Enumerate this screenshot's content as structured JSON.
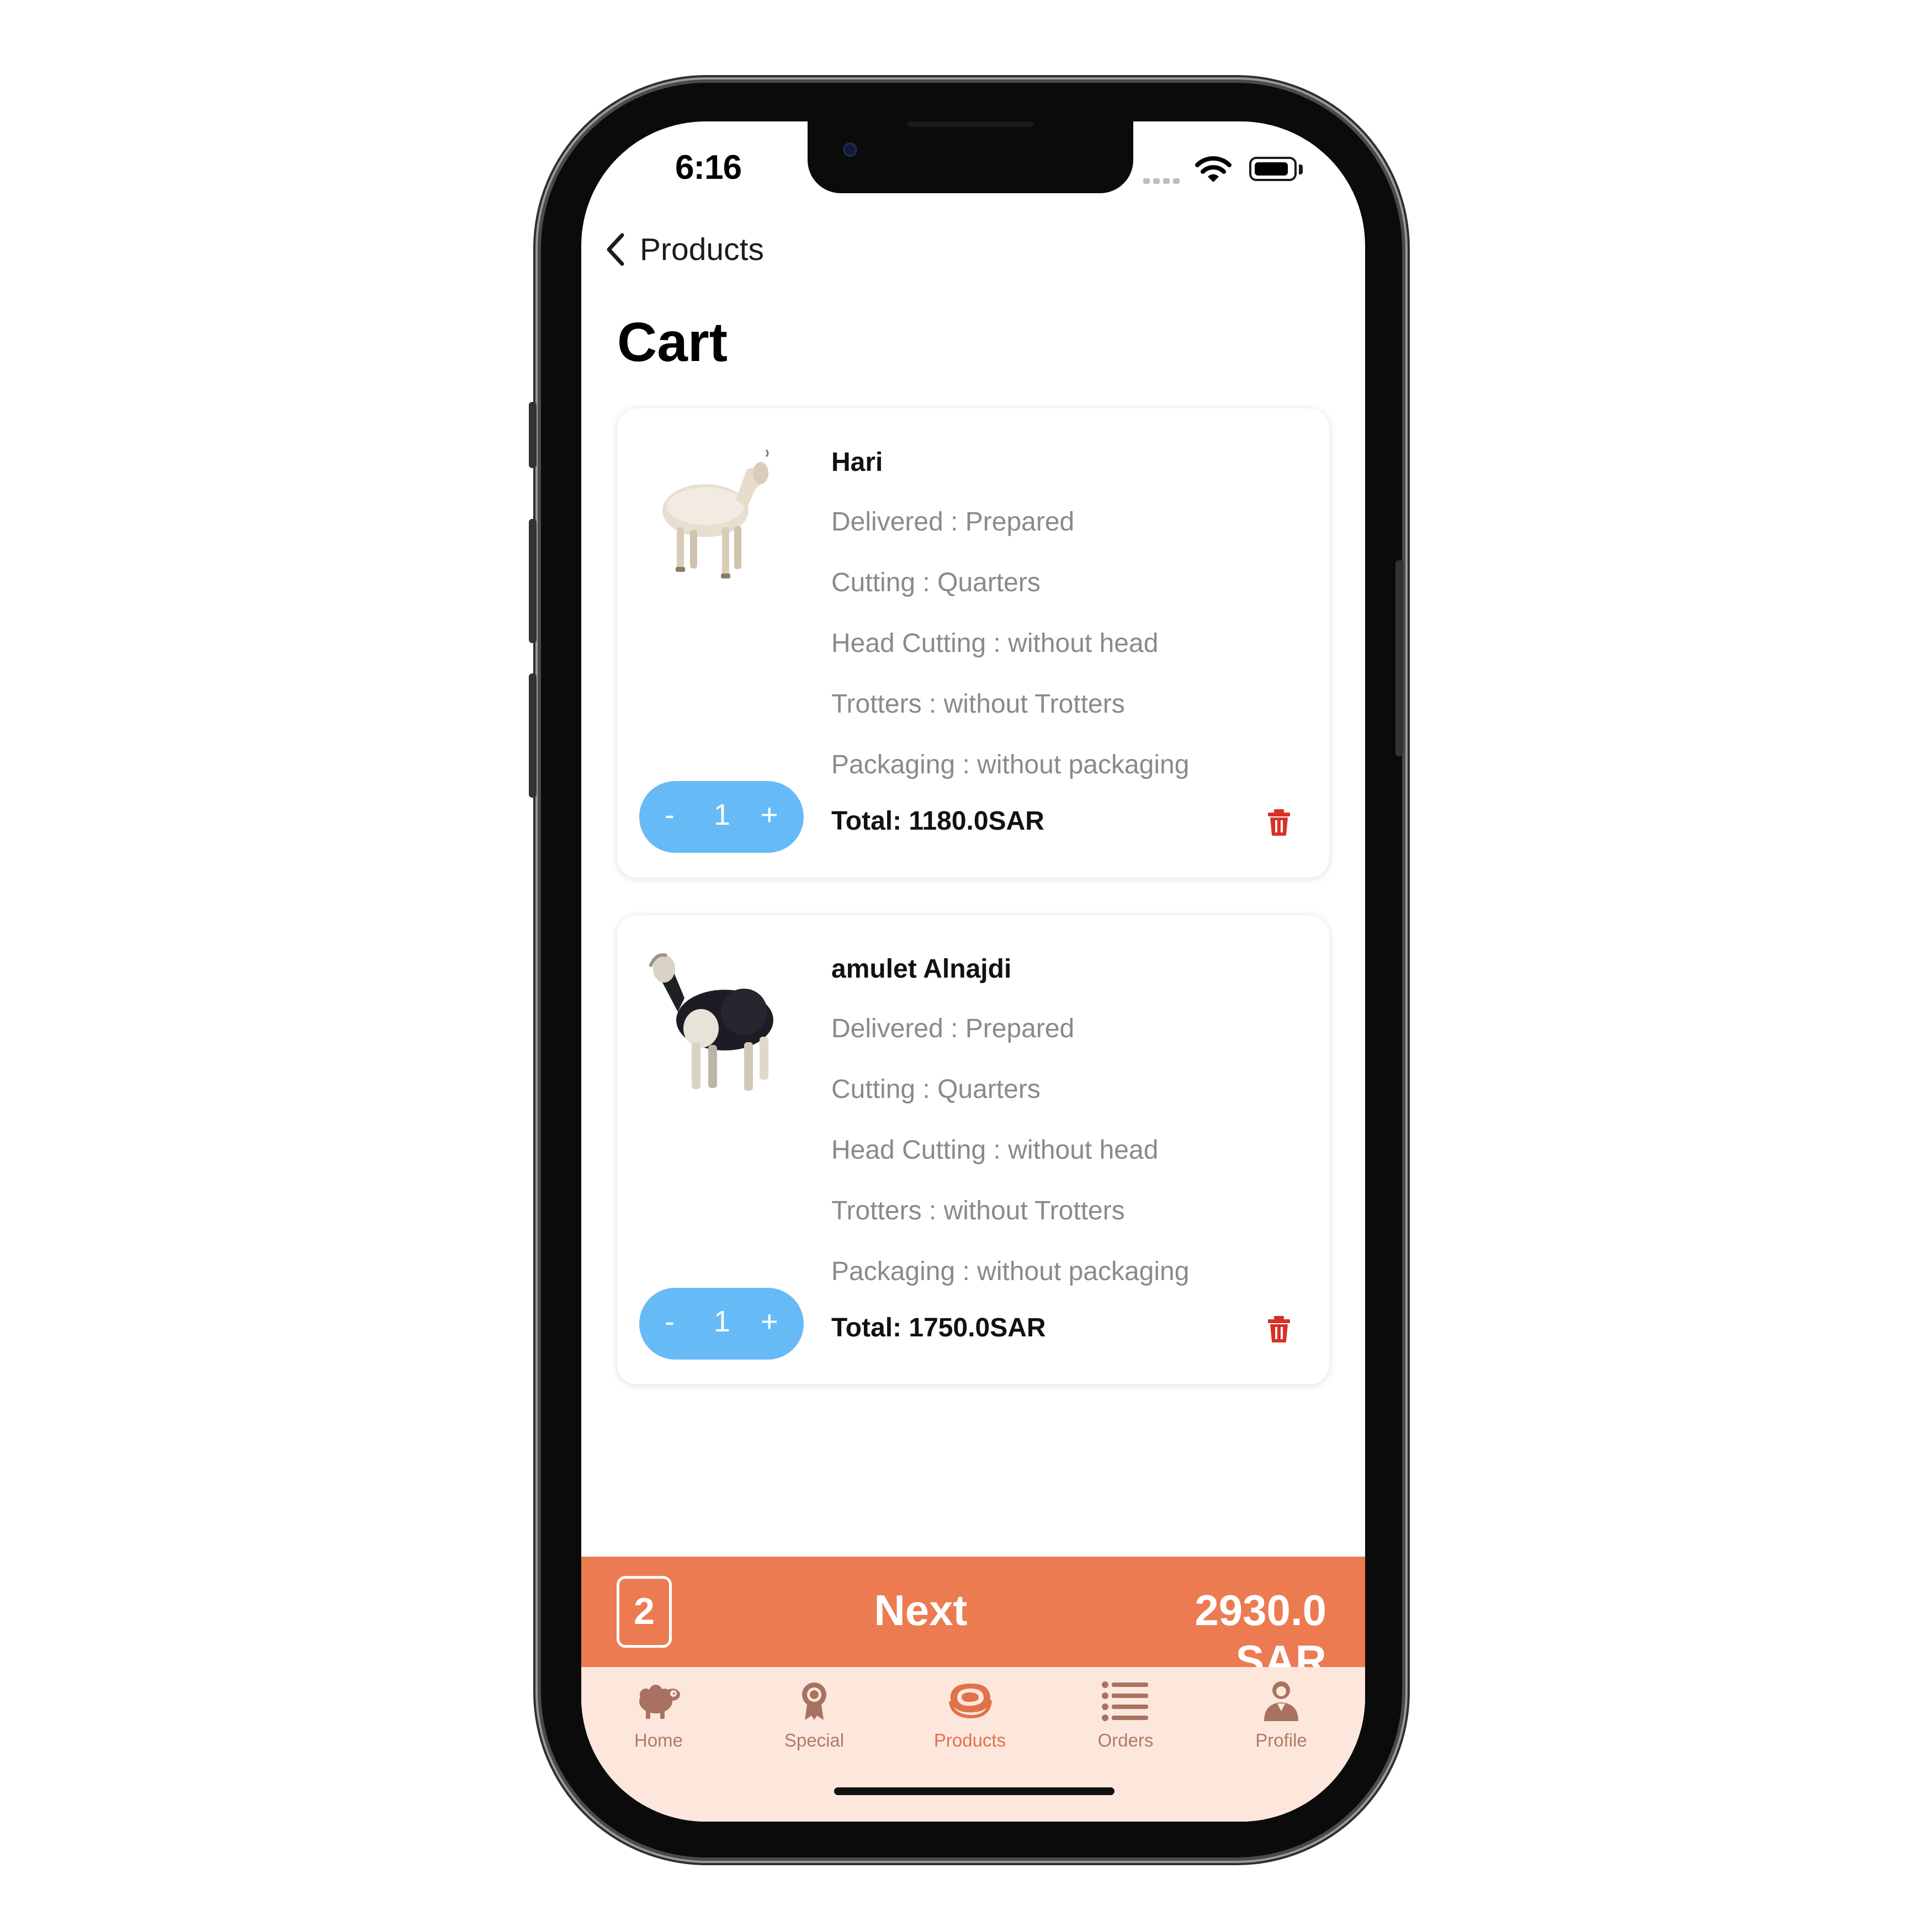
{
  "status_bar": {
    "time": "6:16"
  },
  "nav": {
    "back_label": "Products"
  },
  "page": {
    "title": "Cart"
  },
  "cart_items": [
    {
      "name": "Hari",
      "delivered": "Delivered : Prepared",
      "cutting": "Cutting : Quarters",
      "head_cutting": "Head Cutting : without head",
      "trotters": "Trotters : without Trotters",
      "packaging": "Packaging : without packaging",
      "total": "Total: 1180.0SAR",
      "quantity": "1",
      "minus": "-",
      "plus": "+"
    },
    {
      "name": "amulet Alnajdi",
      "delivered": "Delivered : Prepared",
      "cutting": "Cutting : Quarters",
      "head_cutting": "Head Cutting : without head",
      "trotters": "Trotters : without Trotters",
      "packaging": "Packaging : without packaging",
      "total": "Total: 1750.0SAR",
      "quantity": "1",
      "minus": "-",
      "plus": "+"
    }
  ],
  "checkout": {
    "item_count": "2",
    "next_label": "Next",
    "grand_total": "2930.0 SAR"
  },
  "tabbar": {
    "items": [
      {
        "label": "Home",
        "icon": "sheep-icon"
      },
      {
        "label": "Special",
        "icon": "award-icon"
      },
      {
        "label": "Products",
        "icon": "meat-icon"
      },
      {
        "label": "Orders",
        "icon": "list-icon"
      },
      {
        "label": "Profile",
        "icon": "person-icon"
      }
    ],
    "active": "Products"
  },
  "colors": {
    "accent": "#ec7b51",
    "stepper": "#66bbf7",
    "delete": "#d93025",
    "tabbar_bg": "#fde7dc"
  }
}
